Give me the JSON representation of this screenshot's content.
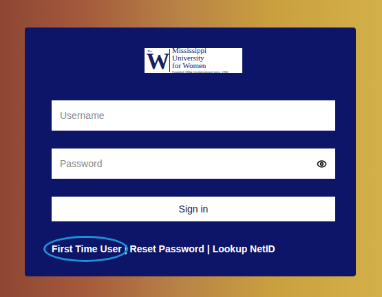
{
  "logo": {
    "prefix": "The",
    "letter": "W",
    "name_line1": "Mississippi University",
    "name_line2": "for Women",
    "tagline": "Founded 1884 Coeducational since 1982"
  },
  "form": {
    "username": {
      "placeholder": "Username"
    },
    "password": {
      "placeholder": "Password"
    },
    "submit": "Sign in"
  },
  "links": [
    {
      "label": "First Time User",
      "circled": true
    },
    {
      "label": "Reset Password",
      "circled": false
    },
    {
      "label": "Lookup NetID",
      "circled": false
    }
  ],
  "separator": "|"
}
